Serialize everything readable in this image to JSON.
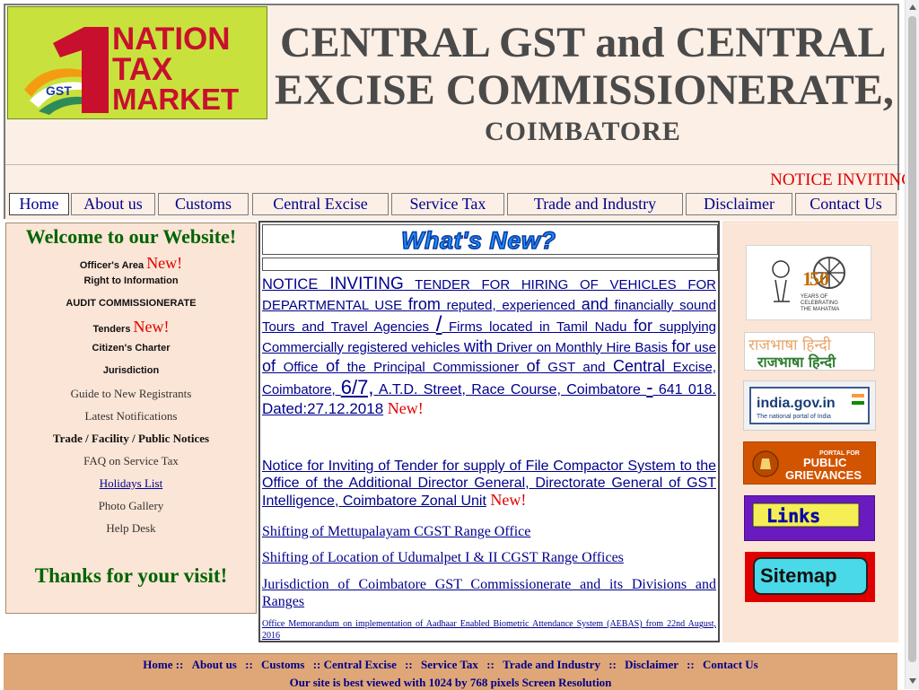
{
  "header": {
    "logo": {
      "nation": "NATION",
      "tax": "TAX",
      "market": "MARKET",
      "gst": "GST"
    },
    "title_line1": "CENTRAL GST and CENTRAL",
    "title_line2": "EXCISE COMMISSIONERATE,",
    "title_line3": "COIMBATORE",
    "marquee": "NOTICE INVITING"
  },
  "nav": [
    {
      "label": "Home"
    },
    {
      "label": "About us"
    },
    {
      "label": "Customs"
    },
    {
      "label": "Central Excise"
    },
    {
      "label": "Service Tax"
    },
    {
      "label": "Trade and Industry"
    },
    {
      "label": "Disclaimer"
    },
    {
      "label": "Contact Us"
    }
  ],
  "sidebar": {
    "welcome": "Welcome to our Website!",
    "items": [
      {
        "label": "Officer's Area",
        "new": "New!"
      },
      {
        "label": "Right to Information"
      },
      {
        "label": "AUDIT COMMISSIONERATE"
      },
      {
        "label": "Tenders",
        "new": "New!"
      },
      {
        "label": "Citizen's Charter"
      },
      {
        "label": "Jurisdiction"
      },
      {
        "label": "Guide to New Registrants"
      },
      {
        "label": "Latest Notifications"
      },
      {
        "label": "Trade / Facility / Public Notices"
      },
      {
        "label": "FAQ on Service Tax"
      },
      {
        "label": "Holidays List"
      },
      {
        "label": "Photo Gallery"
      },
      {
        "label": "Help Desk"
      }
    ],
    "thanks": "Thanks for your visit!"
  },
  "whats_new": {
    "title": "What's New?",
    "notice1": {
      "p1": "NOTICE ",
      "p2": "INVITING",
      "p3": " TENDER FOR HIRING OF VEHICLES FOR DEPARTMENTAL USE ",
      "p4": "from",
      "p5": " reputed, experienced ",
      "p6": "and",
      "p7": " financially sound Tours and Travel Agencies ",
      "p8": "/",
      "p9": " Firms located in Tamil Nadu ",
      "p10": "for",
      "p11": " supplying Commercially registered vehicles ",
      "p12": "with",
      "p13": " Driver on Monthly Hire Basis ",
      "p14": "for",
      "p15": " use ",
      "p16": "of",
      "p17": " Office ",
      "p18": "of",
      "p19": " the Principal Commissioner ",
      "p20": "of",
      "p21": " GST and ",
      "p22": "Central",
      "p23": " Excise, Coimbatore, ",
      "p24": "6/7,",
      "p25": " A.T.D. Street, Race Course, Coimbatore ",
      "p26": "-",
      "p27": " 641 018. ",
      "p28": "Dated:27.12.2018",
      "new": "New!"
    },
    "notice2": {
      "text": "Notice for Inviting of Tender  for supply of File Compactor System to the Office of the Additional Director General, Directorate General of GST Intelligence, Coimbatore Zonal Unit",
      "new": "New!"
    },
    "notice3": "Shifting of Mettupalayam CGST Range Office",
    "notice4": "Shifting of Location of Udumalpet I & II CGST Range Offices",
    "notice5": "Jurisdiction of Coimbatore GST Commissionerate and its Divisions and Ranges",
    "notice6": "Office Memorandum on implementation of Aadhaar Enabled Biometric Attendance System (AEBAS) from 22nd August, 2016"
  },
  "right_banners": {
    "gandhi": {
      "num1": "1",
      "num2": "50",
      "line1": "YEARS OF",
      "line2": "CELEBRATING",
      "line3": "THE MAHATMA"
    },
    "rajbhasha": {
      "line1": "राजभाषा हिन्दी",
      "line2": "राजभाषा हिन्दी"
    },
    "india": {
      "main": "india.gov.in",
      "sub": "The national portal of India"
    },
    "grievances": {
      "portal": "PORTAL FOR",
      "public": "PUBLIC",
      "griev": "GRIEVANCES"
    },
    "links": "Links",
    "sitemap": "Sitemap"
  },
  "footer": {
    "links": [
      "Home",
      "About us",
      "Customs",
      "Central Excise",
      "Service Tax",
      "Trade and Industry",
      "Disclaimer",
      "Contact Us"
    ],
    "sep": "::",
    "note": "Our site is best viewed with 1024 by 768 pixels Screen Resolution"
  }
}
